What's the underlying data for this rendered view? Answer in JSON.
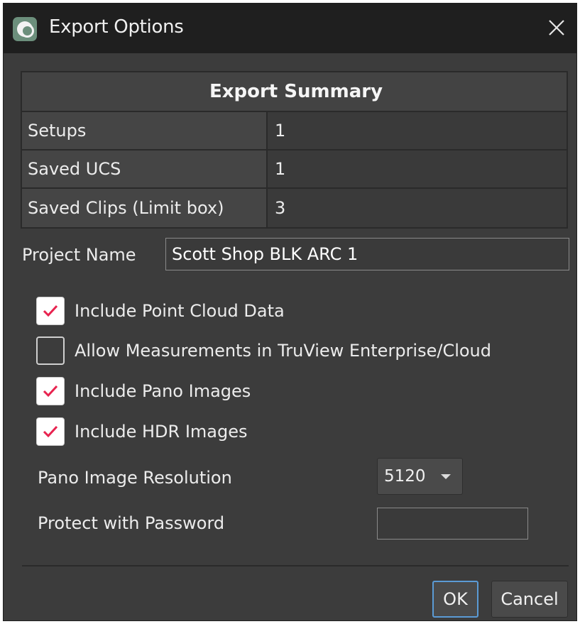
{
  "window": {
    "title": "Export Options"
  },
  "summary": {
    "header": "Export Summary",
    "rows": [
      {
        "label": "Setups",
        "value": "1"
      },
      {
        "label": "Saved UCS",
        "value": "1"
      },
      {
        "label": "Saved Clips (Limit box)",
        "value": "3"
      }
    ]
  },
  "project": {
    "label": "Project Name",
    "value": "Scott Shop BLK ARC 1"
  },
  "options": [
    {
      "label": "Include Point Cloud Data",
      "checked": true
    },
    {
      "label": "Allow Measurements in TruView Enterprise/Cloud",
      "checked": false
    },
    {
      "label": "Include Pano Images",
      "checked": true
    },
    {
      "label": "Include HDR Images",
      "checked": true
    }
  ],
  "resolution": {
    "label": "Pano Image Resolution",
    "value": "5120"
  },
  "password": {
    "label": "Protect with Password",
    "value": ""
  },
  "buttons": {
    "ok": "OK",
    "cancel": "Cancel"
  },
  "colors": {
    "check_mark": "#e8234f",
    "title_bar": "#1f1f1f",
    "dialog_bg": "#3c3c3c",
    "focus_border": "#5b9bd5"
  }
}
